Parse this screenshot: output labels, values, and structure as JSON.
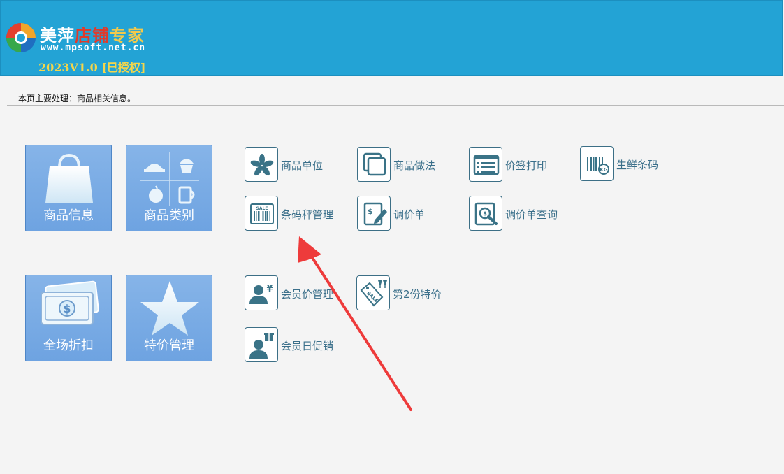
{
  "header": {
    "title_part1": "美萍",
    "title_part2": "店铺",
    "title_part3": "专家",
    "url": "www.mpsoft.net.cn",
    "version": "2023V1.0 [已授权]"
  },
  "status_text": "本页主要处理：商品相关信息。",
  "tiles": [
    {
      "label": "商品信息",
      "icon": "shopping-bag-icon"
    },
    {
      "label": "商品类别",
      "icon": "category-icon"
    },
    {
      "label": "全场折扣",
      "icon": "money-icon"
    },
    {
      "label": "特价管理",
      "icon": "star-icon"
    }
  ],
  "items": [
    {
      "label": "商品单位",
      "icon": "asterisk-icon"
    },
    {
      "label": "商品做法",
      "icon": "copy-icon"
    },
    {
      "label": "价签打印",
      "icon": "list-icon"
    },
    {
      "label": "生鲜条码",
      "icon": "kg-barcode-icon"
    },
    {
      "label": "条码秤管理",
      "icon": "sale-barcode-icon"
    },
    {
      "label": "调价单",
      "icon": "price-edit-icon"
    },
    {
      "label": "调价单查询",
      "icon": "search-doc-icon"
    },
    {
      "label": "会员价管理",
      "icon": "member-price-icon"
    },
    {
      "label": "第2份特价",
      "icon": "sale-tag-icon"
    },
    {
      "label": "会员日促销",
      "icon": "member-gift-icon"
    }
  ],
  "colors": {
    "header_bg": "#23a3d5",
    "tile_bg": "#78aae4",
    "item_text": "#3a6f8a",
    "arrow": "#ee3b3b"
  }
}
